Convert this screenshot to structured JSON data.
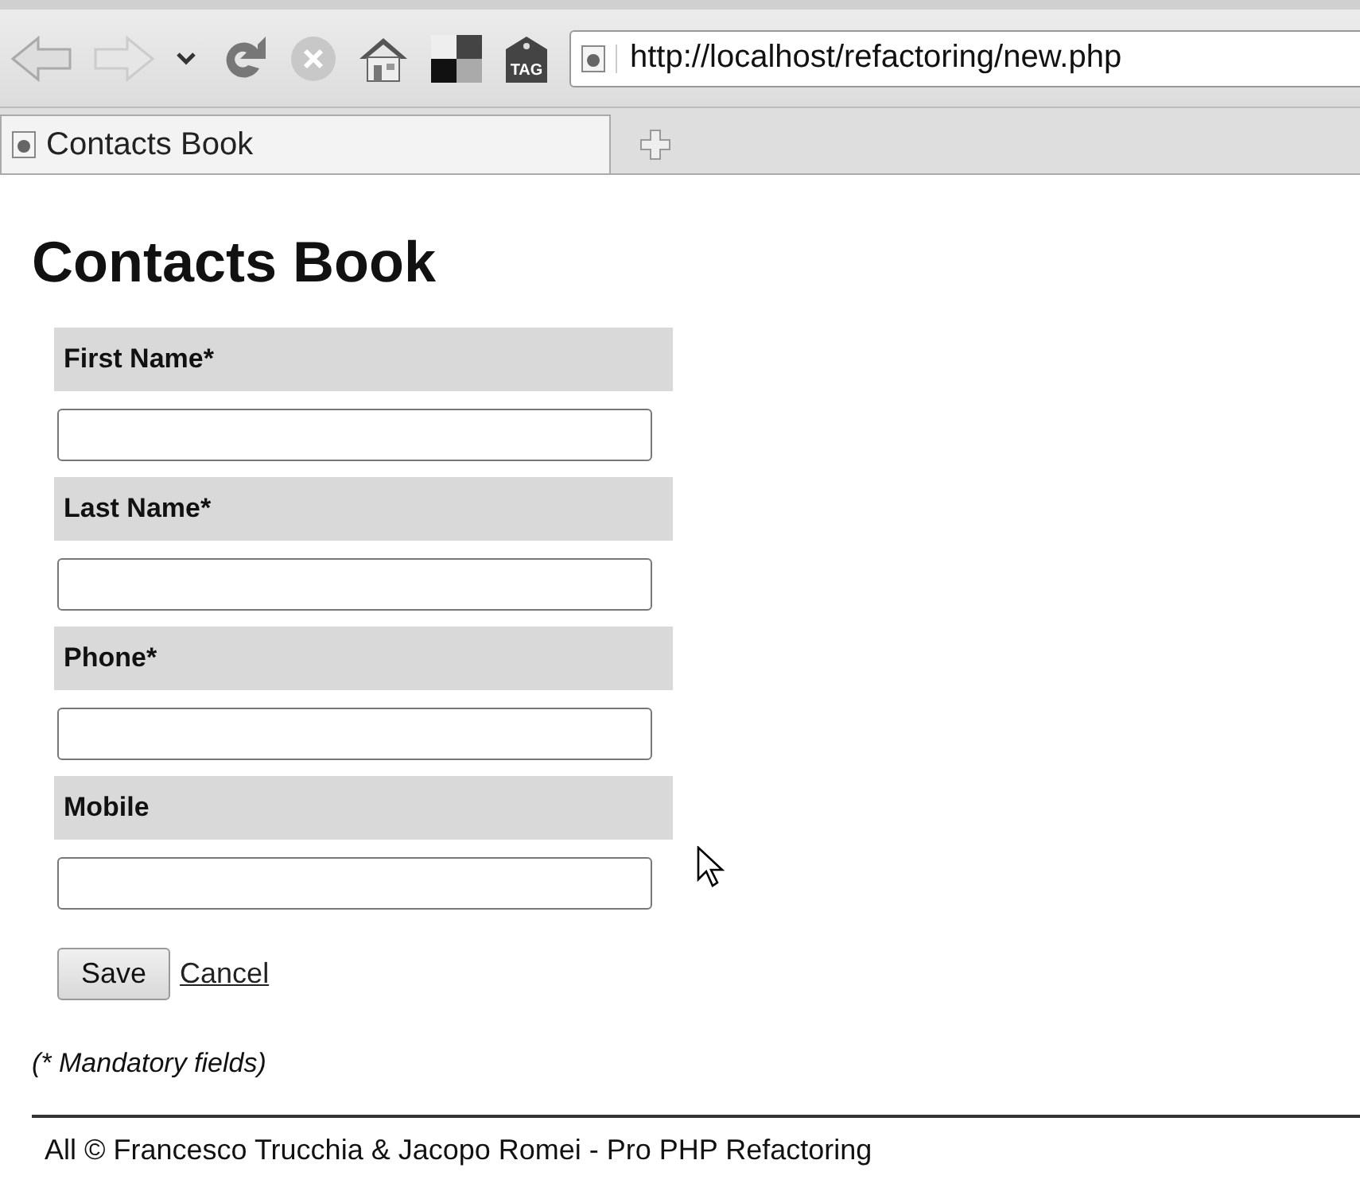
{
  "browser": {
    "tag_icon_label": "TAG",
    "address": "http://localhost/refactoring/new.php",
    "tabs": [
      {
        "title": "Contacts Book",
        "selected": true
      }
    ]
  },
  "page": {
    "heading": "Contacts Book",
    "fields": [
      {
        "label": "First Name*"
      },
      {
        "label": "Last Name*"
      },
      {
        "label": "Phone*"
      },
      {
        "label": "Mobile"
      }
    ],
    "save_button": "Save",
    "cancel_link": "Cancel",
    "note": "(* Mandatory fields)",
    "footer": "All © Francesco Trucchia & Jacopo Romei - Pro PHP Refactoring"
  }
}
